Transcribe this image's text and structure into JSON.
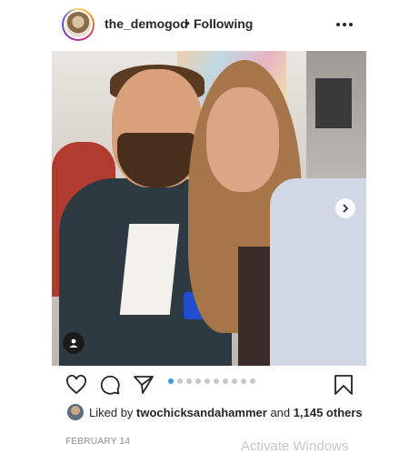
{
  "header": {
    "username": "the_demogod",
    "separator": "•",
    "following_label": "Following"
  },
  "post": {
    "slide_count": 10,
    "active_slide": 1
  },
  "likes": {
    "prefix": "Liked by",
    "liker": "twochicksandahammer",
    "connector": "and",
    "others": "1,145 others"
  },
  "date": "FEBRUARY 14",
  "overlay": {
    "watermark": "Activate Windows"
  },
  "icons": {
    "like": "heart-icon",
    "comment": "comment-icon",
    "share": "share-icon",
    "save": "bookmark-icon",
    "more": "more-icon",
    "next": "chevron-right-icon",
    "tags": "user-tag-icon"
  },
  "colors": {
    "accent": "#3897f0",
    "text": "#262626",
    "muted": "#8e8e8e"
  }
}
